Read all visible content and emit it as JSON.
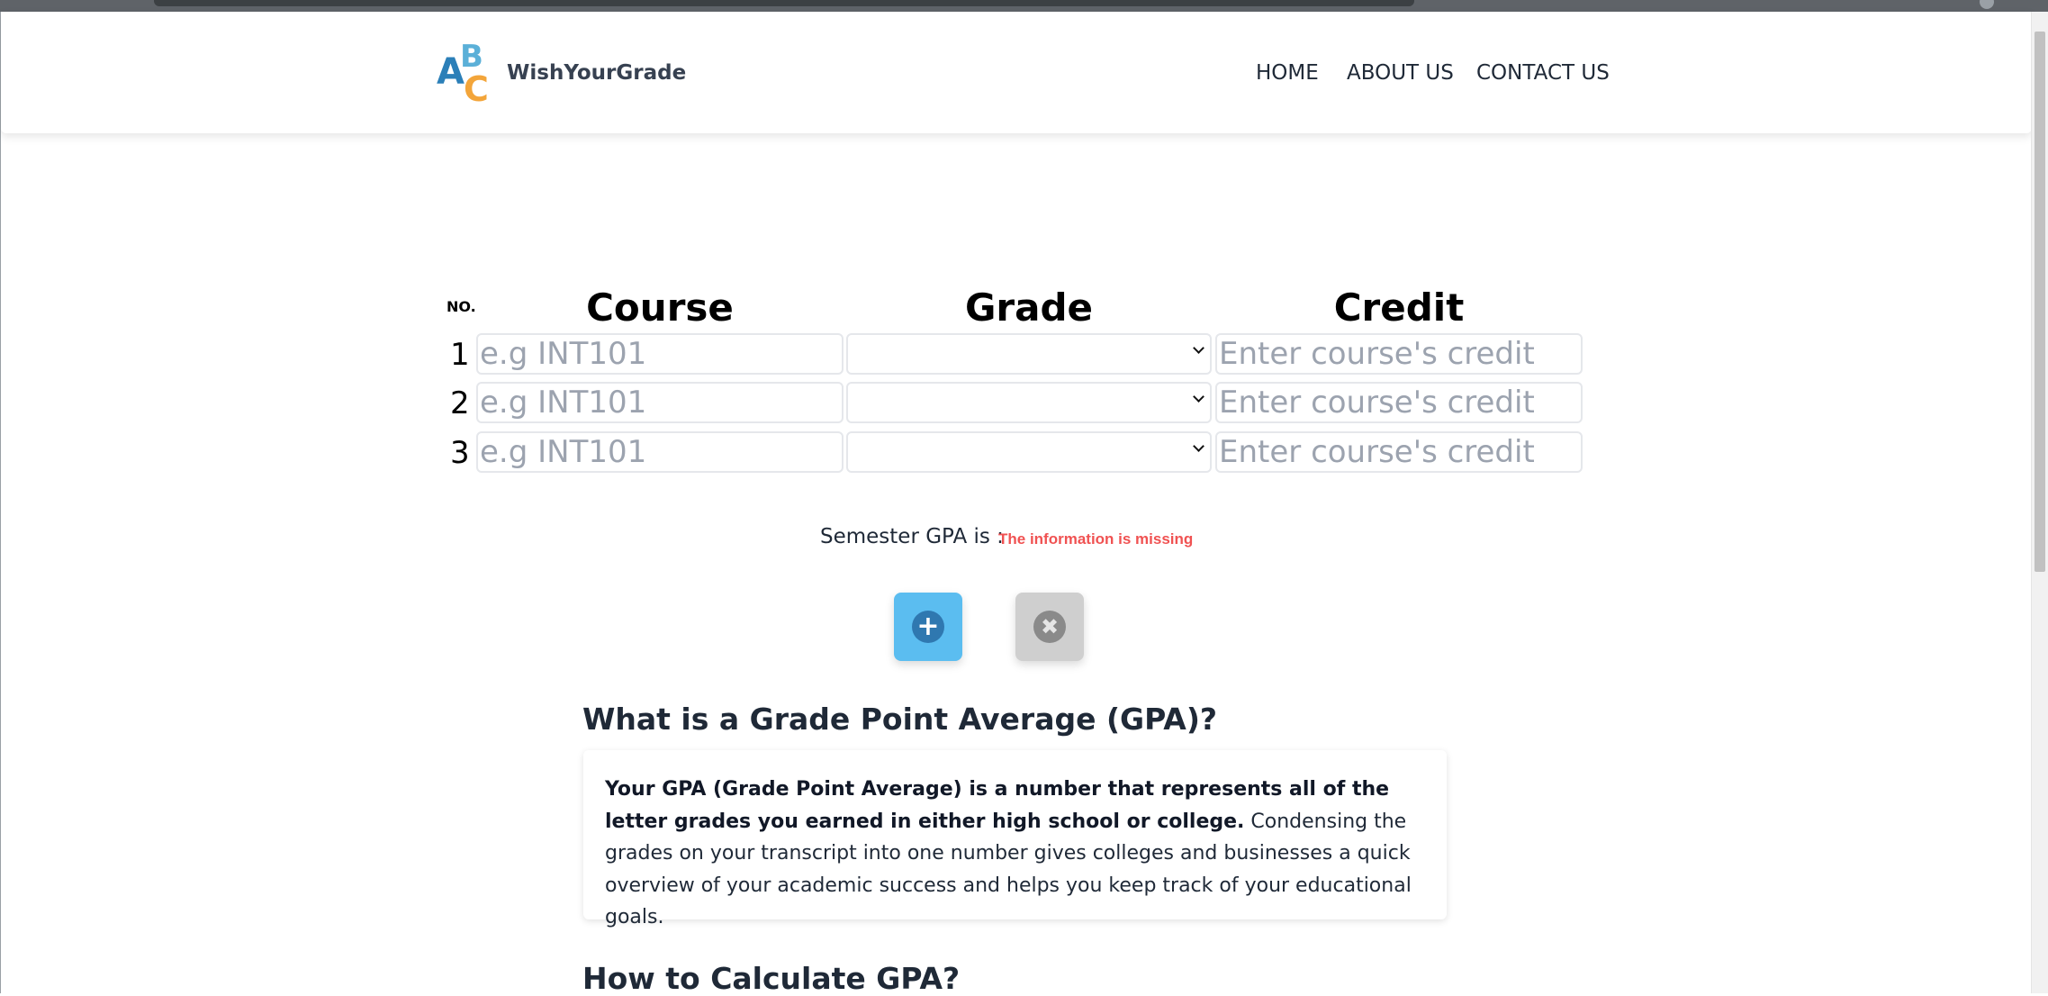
{
  "header": {
    "brand": "WishYourGrade",
    "logo": {
      "a": "A",
      "b": "B",
      "c": "C"
    },
    "nav": {
      "home": "HOME",
      "about": "ABOUT US",
      "contact": "CONTACT US"
    }
  },
  "table": {
    "headers": {
      "no": "NO.",
      "course": "Course",
      "grade": "Grade",
      "credit": "Credit"
    },
    "rows": [
      {
        "no": "1",
        "course_placeholder": "e.g INT101",
        "grade_value": "",
        "credit_placeholder": "Enter course's credit"
      },
      {
        "no": "2",
        "course_placeholder": "e.g INT101",
        "grade_value": "",
        "credit_placeholder": "Enter course's credit"
      },
      {
        "no": "3",
        "course_placeholder": "e.g INT101",
        "grade_value": "",
        "credit_placeholder": "Enter course's credit"
      }
    ]
  },
  "result": {
    "label": "Semester GPA is :",
    "status": "The information is missing"
  },
  "buttons": {
    "add_icon": "plus-icon",
    "add_glyph": "+",
    "clear_icon": "close-icon",
    "clear_glyph": "✖"
  },
  "article": {
    "what_title": "What is a Grade Point Average (GPA)?",
    "what_bold": "Your GPA (Grade Point Average) is a number that represents all of the letter grades you earned in either high school or college.",
    "what_text": " Condensing the grades on your transcript into one number gives colleges and businesses a quick overview of your academic success and helps you keep track of your educational goals.",
    "how_title": "How to Calculate GPA?"
  },
  "colors": {
    "accent_blue": "#5bbdf0",
    "error_red": "#f05252",
    "clear_gray": "#cfcfcf"
  }
}
